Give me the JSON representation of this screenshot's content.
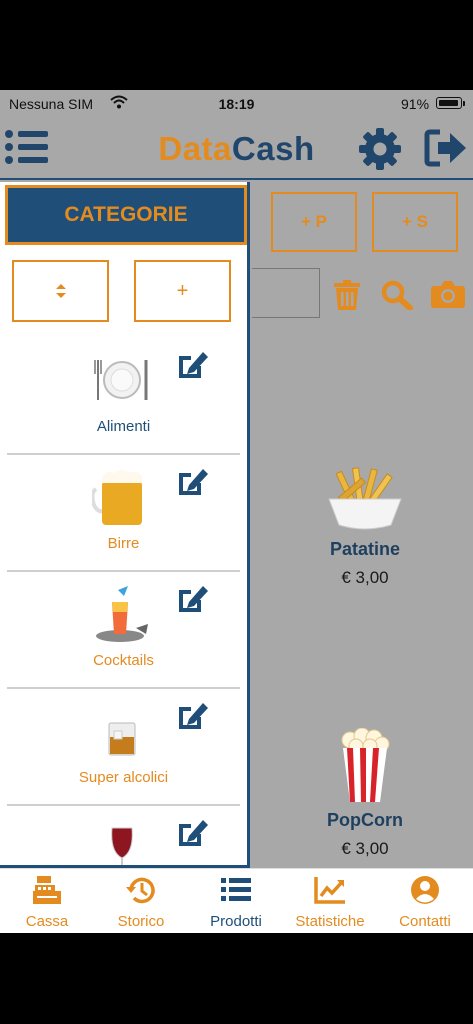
{
  "status_bar": {
    "carrier": "Nessuna SIM",
    "time": "18:19",
    "battery": "91%"
  },
  "header": {
    "logo_part1": "Data",
    "logo_part2": "Cash"
  },
  "toolbar": {
    "add_p_label": "+ P",
    "add_s_label": "+ S"
  },
  "drawer": {
    "title": "CATEGORIE",
    "sort_label": "⬍",
    "add_label": "+",
    "categories": [
      {
        "label": "Alimenti",
        "color": "#1f4f78",
        "icon": "plate-icon"
      },
      {
        "label": "Birre",
        "color": "#e48b1f",
        "icon": "beer-icon"
      },
      {
        "label": "Cocktails",
        "color": "#e48b1f",
        "icon": "cocktail-icon"
      },
      {
        "label": "Super alcolici",
        "color": "#e48b1f",
        "icon": "whisky-icon"
      },
      {
        "label": "",
        "color": "#e48b1f",
        "icon": "wine-icon"
      }
    ]
  },
  "products": [
    {
      "name": "Patatine",
      "price": "€ 3,00",
      "icon": "fries-icon"
    },
    {
      "name": "PopCorn",
      "price": "€ 3,00",
      "icon": "popcorn-icon"
    }
  ],
  "tabs": [
    {
      "label": "Cassa",
      "icon": "cash-register-icon",
      "color": "#e48b1f"
    },
    {
      "label": "Storico",
      "icon": "history-icon",
      "color": "#e48b1f"
    },
    {
      "label": "Prodotti",
      "icon": "list-icon",
      "color": "#1f4f78"
    },
    {
      "label": "Statistiche",
      "icon": "chart-icon",
      "color": "#e48b1f"
    },
    {
      "label": "Contatti",
      "icon": "user-icon",
      "color": "#e48b1f"
    }
  ],
  "colors": {
    "accent": "#e48b1f",
    "primary": "#1f4f78",
    "dim": "#a8a8a8"
  }
}
